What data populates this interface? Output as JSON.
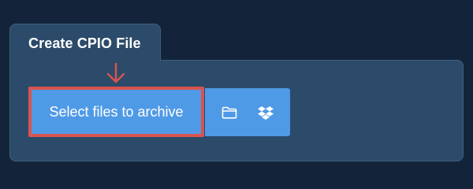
{
  "tab": {
    "title": "Create CPIO File"
  },
  "upload": {
    "select_label": "Select files to archive",
    "folder_icon": "folder-icon",
    "dropbox_icon": "dropbox-icon"
  },
  "annotation": {
    "arrow_icon": "arrow-down-icon",
    "highlight_color": "#d9534f"
  },
  "colors": {
    "background": "#13243a",
    "panel": "#2c4b6a",
    "button": "#4f9ae6",
    "text": "#ffffff"
  }
}
